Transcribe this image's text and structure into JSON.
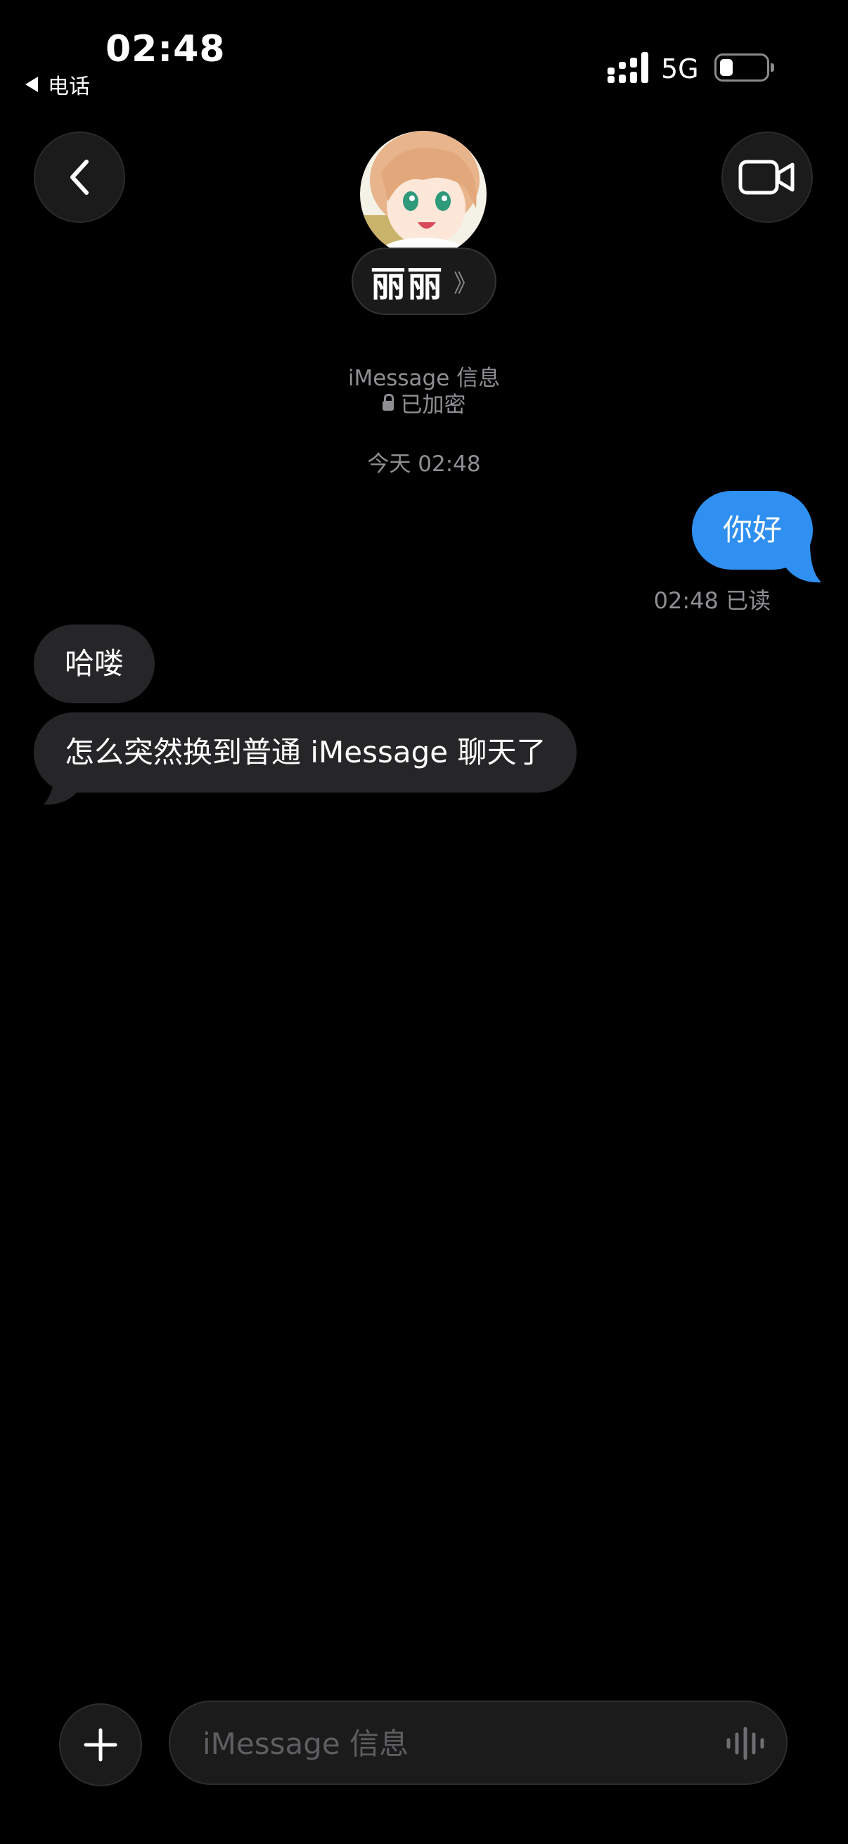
{
  "status_bar": {
    "time": "02:48",
    "back_app_label": "电话",
    "network": "5G"
  },
  "header": {
    "contact_name": "丽丽",
    "chevron": "》",
    "icons": {
      "back": "chevron-left-icon",
      "video": "video-camera-icon"
    }
  },
  "conversation_meta": {
    "service": "iMessage 信息",
    "encryption": "已加密",
    "timestamp": "今天 02:48"
  },
  "messages": [
    {
      "direction": "sent",
      "text": "你好"
    },
    {
      "direction": "received",
      "text": "哈喽"
    },
    {
      "direction": "received",
      "text": "怎么突然换到普通 iMessage 聊天了"
    }
  ],
  "read_receipt": "02:48 已读",
  "composer": {
    "placeholder": "iMessage 信息",
    "value": "",
    "icons": {
      "add": "plus-icon",
      "audio": "audio-waveform-icon"
    }
  },
  "colors": {
    "background": "#000000",
    "sent_bubble": "#2f90f1",
    "received_bubble": "#262628",
    "secondary_text": "#8e8e93"
  }
}
